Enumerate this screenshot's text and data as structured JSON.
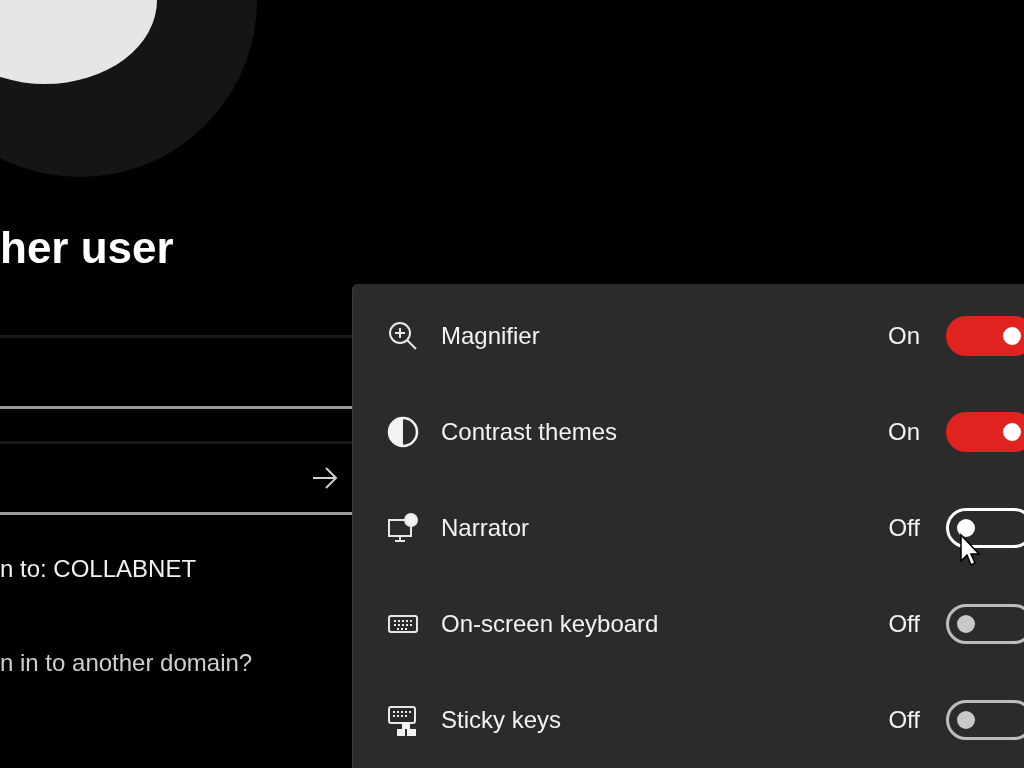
{
  "sign_in": {
    "title": "her user",
    "fields": [
      {
        "kind": "plain"
      },
      {
        "kind": "submit"
      }
    ],
    "domain_text": "n to: COLLABNET",
    "domain_link": "n in to another domain?"
  },
  "accessibility": {
    "items": [
      {
        "label": "Magnifier",
        "state": "On",
        "on": true,
        "hovered": false
      },
      {
        "label": "Contrast themes",
        "state": "On",
        "on": true,
        "hovered": false
      },
      {
        "label": "Narrator",
        "state": "Off",
        "on": false,
        "hovered": true
      },
      {
        "label": "On-screen keyboard",
        "state": "Off",
        "on": false,
        "hovered": false
      },
      {
        "label": "Sticky keys",
        "state": "Off",
        "on": false,
        "hovered": false
      }
    ]
  }
}
